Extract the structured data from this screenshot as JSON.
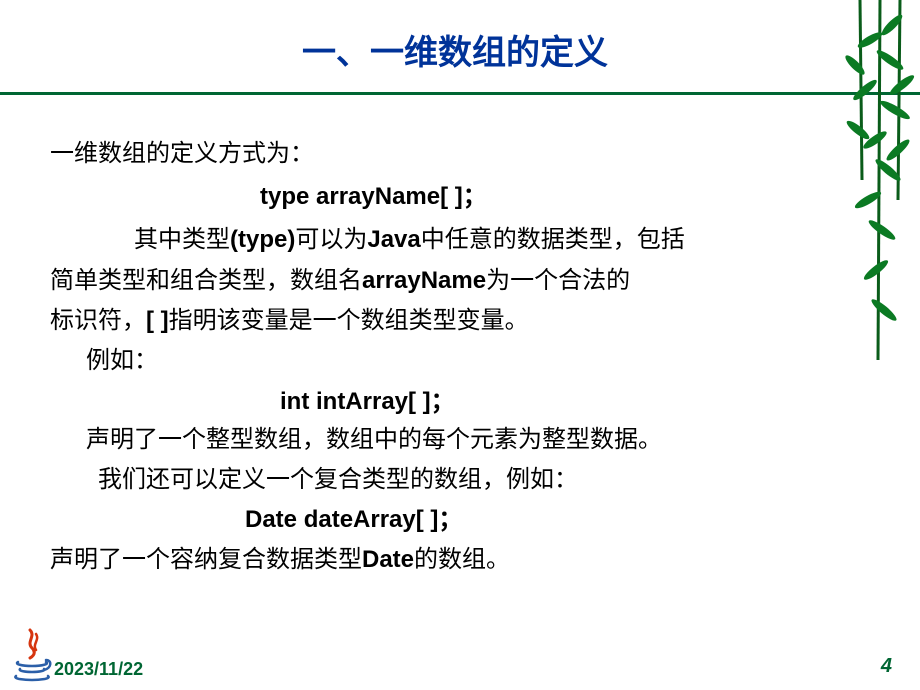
{
  "title": "一、一维数组的定义",
  "lines": {
    "def": "一维数组的定义方式为：",
    "syntax1": "type arrayName[ ]；",
    "body1a": "其中类型(type)可以为Java中任意的数据类型，包括",
    "body1b": "简单类型和组合类型，数组名arrayName为一个合法的",
    "body1c": "标识符，[ ]指明该变量是一个数组类型变量。",
    "example_label": "例如：",
    "syntax2": "int intArray[ ]；",
    "decl1": "声明了一个整型数组，数组中的每个元素为整型数据。",
    "decl2": "我们还可以定义一个复合类型的数组，例如：",
    "syntax3": "Date  dateArray[ ]；",
    "decl3": "声明了一个容纳复合数据类型Date的数组。"
  },
  "footer": {
    "date": "2023/11/22",
    "page": "4"
  }
}
